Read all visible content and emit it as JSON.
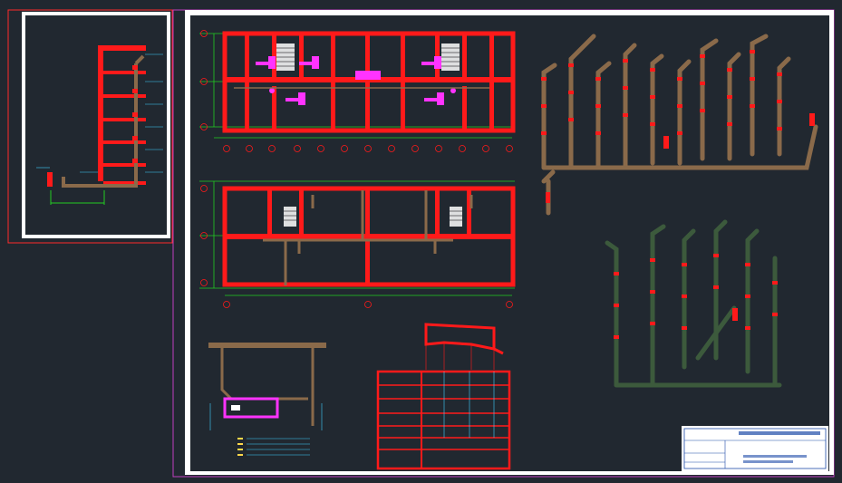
{
  "drawing": {
    "section_left_title": "",
    "floor_plan_title": "",
    "basement_plan_title": "",
    "iso_hot_title": "",
    "iso_cold_title": "",
    "node_title": "",
    "profile_title": "",
    "title_block_text": "",
    "colors": {
      "background": "#212830",
      "sheet": "#ffffff",
      "wall": "#ff1a1a",
      "pipe": "#8a6a4a",
      "grid": "#22cc22",
      "fixture": "#ff33ff",
      "frame": "#c040c0",
      "leader": "#3fd0ff"
    }
  }
}
